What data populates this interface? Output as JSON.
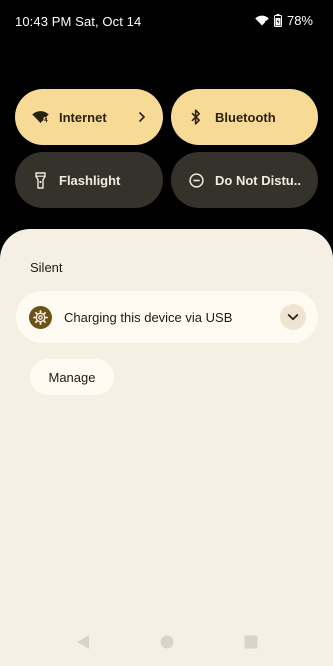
{
  "status_bar": {
    "time": "10:43 PM",
    "date": "Sat, Oct 14",
    "battery": "78%",
    "icons": [
      "wifi-icon",
      "battery-icon"
    ]
  },
  "quick_tiles": [
    {
      "label": "Internet",
      "icon": "wifi-icon",
      "state": "on",
      "has_chevron": true
    },
    {
      "label": "Bluetooth",
      "icon": "bluetooth-icon",
      "state": "on",
      "has_chevron": false
    },
    {
      "label": "Flashlight",
      "icon": "flashlight-icon",
      "state": "off",
      "has_chevron": false
    },
    {
      "label": "Do Not Distu..",
      "icon": "do-not-disturb-icon",
      "state": "off",
      "has_chevron": false
    }
  ],
  "notifications": {
    "section_label": "Silent",
    "items": [
      {
        "title": "Charging this device via USB",
        "icon": "settings-gear-icon"
      }
    ],
    "manage_label": "Manage"
  },
  "nav_bar": {
    "buttons": [
      "back-icon",
      "home-icon",
      "recents-icon"
    ]
  },
  "colors": {
    "tile_on": "#f8da97",
    "tile_off": "#35322c",
    "shade_bg": "#f6f0e4",
    "card_bg": "#fffbf3",
    "app_icon": "#6b5317"
  }
}
